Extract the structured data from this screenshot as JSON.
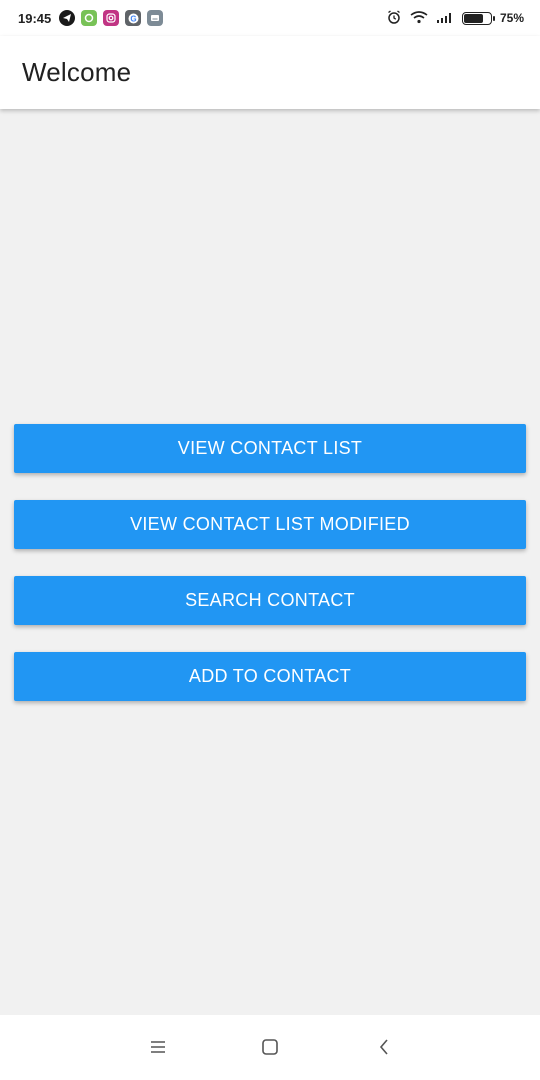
{
  "status_bar": {
    "time": "19:45",
    "battery_percent": "75%",
    "battery_level": 0.75,
    "notification_icons": [
      {
        "name": "telegram-icon",
        "color": "#1a1a1a"
      },
      {
        "name": "android-icon",
        "color": "#78c257"
      },
      {
        "name": "instagram-icon",
        "color": "#c13584"
      },
      {
        "name": "google-icon",
        "color": "#5f6368"
      },
      {
        "name": "keyboard-icon",
        "color": "#7d8b96"
      }
    ]
  },
  "app_bar": {
    "title": "Welcome"
  },
  "buttons": {
    "view_contact_list": "VIEW CONTACT LIST",
    "view_contact_list_modified": "VIEW CONTACT LIST MODIFIED",
    "search_contact": "SEARCH CONTACT",
    "add_to_contact": "ADD TO CONTACT"
  },
  "colors": {
    "accent": "#2196f3",
    "background": "#f1f1f1",
    "app_bar": "#ffffff"
  },
  "nav_bar": {
    "icons": [
      "menu-icon",
      "home-icon",
      "back-icon"
    ]
  }
}
